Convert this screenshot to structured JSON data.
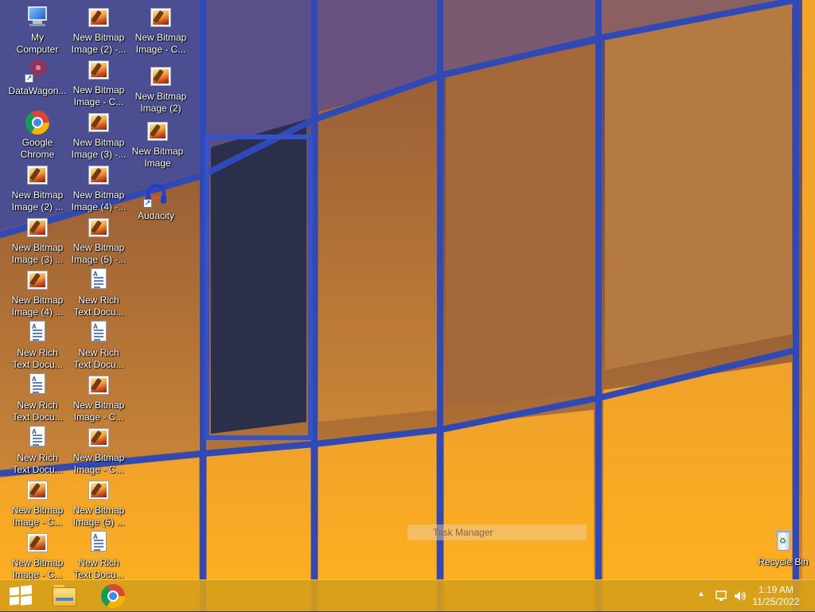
{
  "desktop": {
    "icons": [
      {
        "id": "my-computer",
        "type": "pc",
        "label": "My\nComputer"
      },
      {
        "id": "datawagon",
        "type": "datawagon",
        "label": "DataWagon..."
      },
      {
        "id": "google-chrome",
        "type": "chrome",
        "label": "Google\nChrome"
      },
      {
        "id": "bmp-2-a",
        "type": "bitmap",
        "label": "New Bitmap\nImage (2) ..."
      },
      {
        "id": "bmp-3-a",
        "type": "bitmap",
        "label": "New Bitmap\nImage (3) ..."
      },
      {
        "id": "bmp-4-a",
        "type": "bitmap",
        "label": "New Bitmap\nImage (4) ..."
      },
      {
        "id": "rtf-a",
        "type": "rtf",
        "label": "New Rich\nText Docu..."
      },
      {
        "id": "rtf-b",
        "type": "rtf",
        "label": "New Rich\nText Docu..."
      },
      {
        "id": "rtf-c",
        "type": "rtf",
        "label": "New Rich\nText Docu..."
      },
      {
        "id": "bmp-c-a",
        "type": "bitmap",
        "label": "New Bitmap\nImage - C..."
      },
      {
        "id": "bmp-c-b",
        "type": "bitmap",
        "label": "New Bitmap\nImage - C..."
      },
      {
        "id": "bmp-2-b",
        "type": "bitmap",
        "label": "New Bitmap\nImage (2) -..."
      },
      {
        "id": "bmp-c-c",
        "type": "bitmap",
        "label": "New Bitmap\nImage - C..."
      },
      {
        "id": "bmp-3-b",
        "type": "bitmap",
        "label": "New Bitmap\nImage (3) -..."
      },
      {
        "id": "bmp-4-b",
        "type": "bitmap",
        "label": "New Bitmap\nImage (4) -..."
      },
      {
        "id": "bmp-5-a",
        "type": "bitmap",
        "label": "New Bitmap\nImage (5) -..."
      },
      {
        "id": "rtf-d",
        "type": "rtf",
        "label": "New Rich\nText Docu..."
      },
      {
        "id": "rtf-e",
        "type": "rtf",
        "label": "New Rich\nText Docu..."
      },
      {
        "id": "bmp-c-d",
        "type": "bitmap",
        "label": "New Bitmap\nImage - C..."
      },
      {
        "id": "bmp-c-e",
        "type": "bitmap",
        "label": "New Bitmap\nImage - C..."
      },
      {
        "id": "bmp-5-b",
        "type": "bitmap",
        "label": "New Bitmap\nImage (5) ..."
      },
      {
        "id": "rtf-f",
        "type": "rtf",
        "label": "New Rich\nText Docu..."
      },
      {
        "id": "bmp-c-f",
        "type": "bitmap",
        "label": "New Bitmap\nImage - C..."
      },
      {
        "id": "bmp-2-c",
        "type": "bitmap",
        "label": "New Bitmap\nImage (2)"
      },
      {
        "id": "bmp-plain",
        "type": "bitmap",
        "label": "New Bitmap\nImage"
      },
      {
        "id": "audacity",
        "type": "audacity",
        "label": "Audacity"
      }
    ],
    "recycle_bin": {
      "label": "Recycle Bin"
    },
    "ghost_label": "Task Manager"
  },
  "taskbar": {
    "start_icon": "windows-logo-icon",
    "pinned": [
      "file-explorer-icon",
      "chrome-icon"
    ],
    "tray": {
      "time": "1:19 AM",
      "date": "11/25/2022"
    }
  },
  "colors": {
    "taskbar": "#d69e1a",
    "glass_frame": "#2d47b5",
    "warm_glow": "#f5a623"
  }
}
